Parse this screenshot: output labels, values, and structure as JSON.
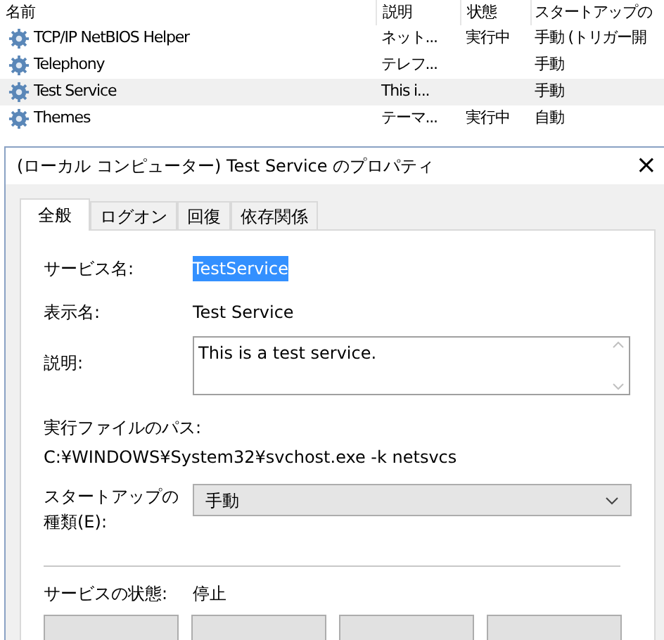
{
  "service_list": {
    "columns": [
      "名前",
      "説明",
      "状態",
      "スタートアップの"
    ],
    "rows": [
      {
        "name": "TCP/IP NetBIOS Helper",
        "description": "ネット...",
        "status": "実行中",
        "startup": "手動 (トリガー開",
        "selected": false
      },
      {
        "name": "Telephony",
        "description": "テレフ...",
        "status": "",
        "startup": "手動",
        "selected": false
      },
      {
        "name": "Test Service",
        "description": "This i...",
        "status": "",
        "startup": "手動",
        "selected": true
      },
      {
        "name": "Themes",
        "description": "テーマ...",
        "status": "実行中",
        "startup": "自動",
        "selected": false
      }
    ]
  },
  "dialog": {
    "title": "(ローカル コンピューター) Test Service のプロパティ",
    "close": "×",
    "tabs": [
      {
        "label": "全般",
        "selected": true
      },
      {
        "label": "ログオン",
        "selected": false
      },
      {
        "label": "回復",
        "selected": false
      },
      {
        "label": "依存関係",
        "selected": false
      }
    ],
    "service_name": {
      "label": "サービス名:",
      "value": "TestService"
    },
    "display_name": {
      "label": "表示名:",
      "value": "Test Service"
    },
    "description": {
      "label": "説明:",
      "value": "This is a test service."
    },
    "path": {
      "label": "実行ファイルのパス:",
      "value": "C:¥WINDOWS¥System32¥svchost.exe -k netsvcs"
    },
    "startup_type": {
      "label": "スタートアップの",
      "label_line_2": "種類(E):",
      "value": "手動"
    },
    "service_status": {
      "label": "サービスの状態:",
      "value": "停止"
    }
  }
}
